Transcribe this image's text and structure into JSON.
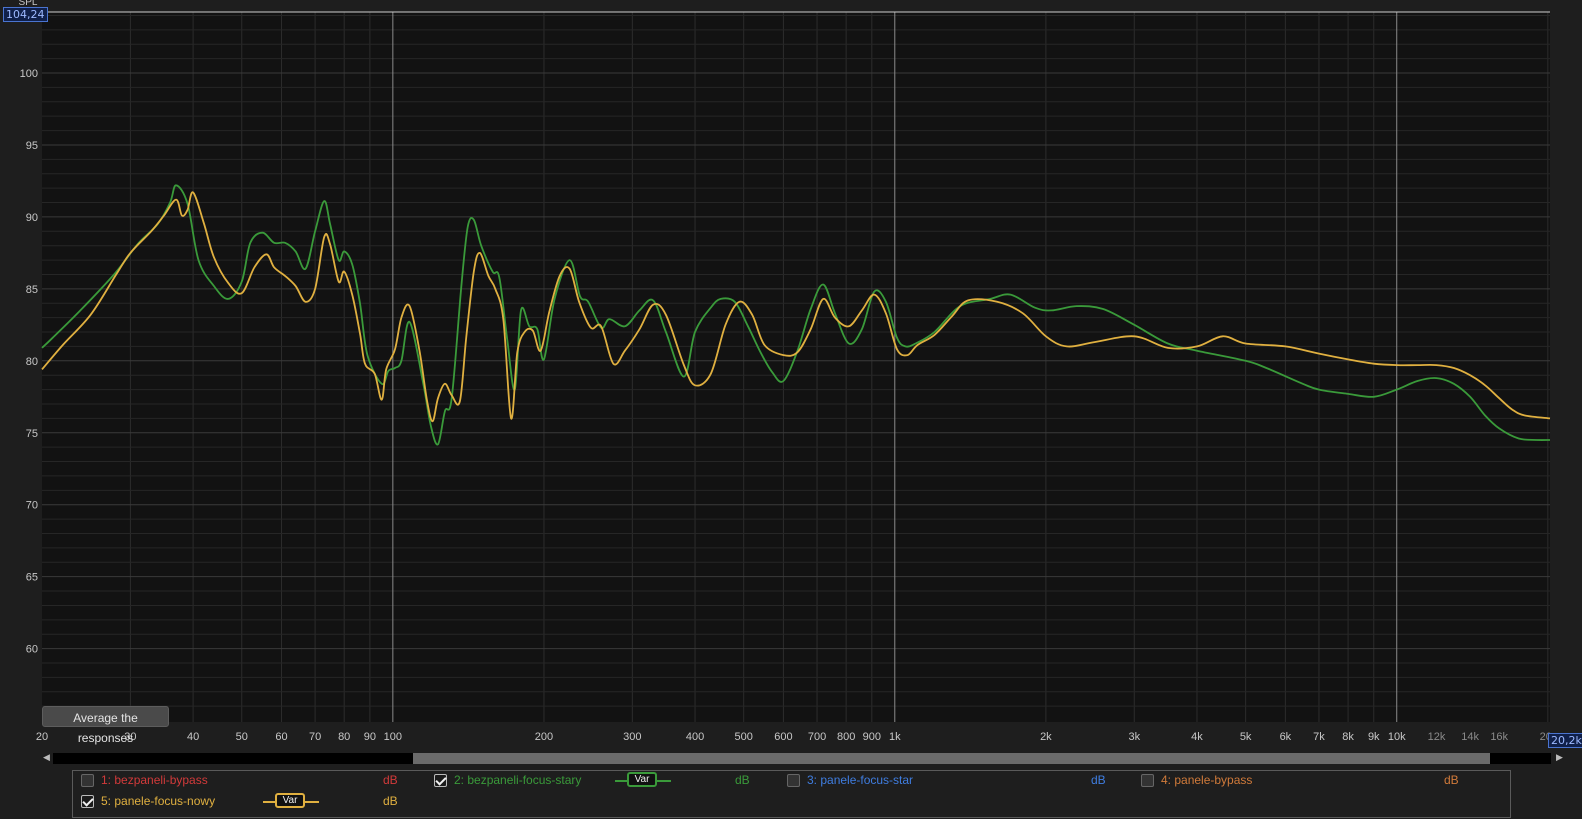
{
  "cursor": {
    "y_readout": "104,24",
    "x_readout": "20,2k",
    "y_axis_unit": "SPL"
  },
  "buttons": {
    "average_label": "Average the responses"
  },
  "legend": [
    {
      "name": "1: bezpaneli-bypass",
      "unit": "dB",
      "checked": false,
      "color": "#d23a3a",
      "show_var": false
    },
    {
      "name": "2: bezpaneli-focus-stary",
      "unit": "dB",
      "checked": true,
      "color": "#3a9a3a",
      "show_var": true,
      "var_label": "Var"
    },
    {
      "name": "3: panele-focus-star",
      "unit": "dB",
      "checked": false,
      "color": "#3f7de0",
      "show_var": false
    },
    {
      "name": "4: panele-bypass",
      "unit": "dB",
      "checked": false,
      "color": "#d07a3a",
      "show_var": false
    },
    {
      "name": "5: panele-focus-nowy",
      "unit": "dB",
      "checked": true,
      "color": "#e0b040",
      "show_var": true,
      "var_label": "Var"
    }
  ],
  "chart_data": {
    "type": "line",
    "title": "",
    "xlabel": "",
    "ylabel": "SPL",
    "x_scale": "log",
    "xlim": [
      20,
      20200
    ],
    "ylim": [
      54.9,
      104.24
    ],
    "grid": true,
    "y_ticks": [
      60,
      65,
      70,
      75,
      80,
      85,
      90,
      95,
      100
    ],
    "x_ticks": [
      {
        "v": 20,
        "label": "20"
      },
      {
        "v": 30,
        "label": "30"
      },
      {
        "v": 40,
        "label": "40"
      },
      {
        "v": 50,
        "label": "50"
      },
      {
        "v": 60,
        "label": "60"
      },
      {
        "v": 70,
        "label": "70"
      },
      {
        "v": 80,
        "label": "80"
      },
      {
        "v": 90,
        "label": "90"
      },
      {
        "v": 100,
        "label": "100"
      },
      {
        "v": 200,
        "label": "200"
      },
      {
        "v": 300,
        "label": "300"
      },
      {
        "v": 400,
        "label": "400"
      },
      {
        "v": 500,
        "label": "500"
      },
      {
        "v": 600,
        "label": "600"
      },
      {
        "v": 700,
        "label": "700"
      },
      {
        "v": 800,
        "label": "800"
      },
      {
        "v": 900,
        "label": "900"
      },
      {
        "v": 1000,
        "label": "1k"
      },
      {
        "v": 2000,
        "label": "2k"
      },
      {
        "v": 3000,
        "label": "3k"
      },
      {
        "v": 4000,
        "label": "4k"
      },
      {
        "v": 5000,
        "label": "5k"
      },
      {
        "v": 6000,
        "label": "6k"
      },
      {
        "v": 7000,
        "label": "7k"
      },
      {
        "v": 8000,
        "label": "8k"
      },
      {
        "v": 9000,
        "label": "9k"
      },
      {
        "v": 10000,
        "label": "10k"
      },
      {
        "v": 12000,
        "label": "12k"
      },
      {
        "v": 14000,
        "label": "14k"
      },
      {
        "v": 16000,
        "label": "16k"
      },
      {
        "v": 20000,
        "label": "20"
      }
    ],
    "series": [
      {
        "name": "2: bezpaneli-focus-stary",
        "color": "#3a9a3a",
        "x": [
          20,
          21,
          24,
          28,
          31,
          34,
          36,
          37,
          39,
          41,
          44,
          47,
          50,
          52,
          55,
          58,
          61,
          64,
          67,
          70,
          73,
          75,
          78,
          80,
          83,
          86,
          89,
          95,
          98,
          101,
          104,
          108,
          115,
          119,
          123,
          127,
          131,
          137,
          141,
          145,
          150,
          158,
          163,
          169,
          175,
          180,
          187,
          194,
          200,
          210,
          225,
          236,
          245,
          260,
          270,
          290,
          310,
          330,
          350,
          380,
          400,
          430,
          450,
          480,
          510,
          540,
          570,
          600,
          640,
          680,
          720,
          760,
          810,
          860,
          910,
          960,
          1010,
          1050,
          1100,
          1200,
          1350,
          1550,
          1700,
          1900,
          2050,
          2300,
          2600,
          3000,
          3500,
          4000,
          5000,
          5500,
          6500,
          7000,
          8000,
          9000,
          10000,
          11000,
          12000,
          13000,
          14000,
          15000,
          16000,
          17500,
          19000,
          20200
        ],
        "y": [
          80.9,
          81.6,
          83.6,
          86.1,
          88.1,
          89.5,
          91.0,
          92.2,
          90.9,
          87.0,
          85.2,
          84.3,
          85.5,
          88.2,
          88.9,
          88.2,
          88.2,
          87.6,
          86.4,
          89.0,
          91.1,
          89.5,
          87.0,
          87.6,
          86.7,
          84.0,
          80.4,
          78.4,
          79.3,
          79.5,
          80.0,
          82.7,
          78.4,
          75.5,
          74.2,
          76.5,
          77.4,
          85.3,
          89.3,
          89.8,
          88.0,
          86.2,
          85.8,
          81.5,
          78.0,
          83.5,
          82.4,
          82.2,
          80.1,
          84.3,
          87.0,
          84.5,
          84.1,
          82.3,
          82.9,
          82.4,
          83.5,
          84.2,
          82.0,
          78.9,
          82.0,
          83.7,
          84.3,
          84.1,
          82.4,
          80.6,
          79.2,
          78.6,
          80.7,
          83.6,
          85.3,
          83.3,
          81.2,
          82.2,
          84.8,
          84.1,
          81.6,
          81.0,
          81.2,
          82.0,
          83.8,
          84.3,
          84.6,
          83.7,
          83.5,
          83.8,
          83.6,
          82.5,
          81.2,
          80.7,
          80.0,
          79.5,
          78.4,
          78.0,
          77.7,
          77.5,
          78.0,
          78.6,
          78.8,
          78.4,
          77.5,
          76.2,
          75.3,
          74.6,
          74.5,
          74.5
        ]
      },
      {
        "name": "5: panele-focus-nowy",
        "color": "#e0b040",
        "x": [
          20,
          22,
          25,
          28,
          30,
          33,
          35,
          37,
          38,
          39,
          40,
          42,
          44,
          47,
          50,
          53,
          56,
          58,
          61,
          64,
          67,
          70,
          73,
          75,
          78,
          80,
          83,
          86,
          88,
          92,
          95,
          97,
          101,
          104,
          108,
          113,
          117,
          120,
          123,
          127,
          131,
          136,
          140,
          145,
          149,
          155,
          160,
          166,
          172,
          177,
          183,
          190,
          197,
          205,
          215,
          225,
          235,
          248,
          260,
          275,
          290,
          310,
          330,
          350,
          380,
          400,
          430,
          460,
          490,
          520,
          550,
          600,
          640,
          680,
          720,
          760,
          810,
          860,
          910,
          960,
          1010,
          1060,
          1110,
          1200,
          1300,
          1400,
          1600,
          1800,
          2000,
          2200,
          2500,
          3000,
          3500,
          4000,
          4500,
          5000,
          6000,
          7000,
          8000,
          9000,
          10000,
          11000,
          12000,
          13000,
          14000,
          15000,
          16000,
          17000,
          18000,
          20200
        ],
        "y": [
          79.4,
          81.1,
          83.2,
          85.9,
          87.5,
          89.0,
          90.1,
          91.2,
          90.1,
          90.5,
          91.7,
          89.6,
          87.2,
          85.4,
          84.7,
          86.5,
          87.4,
          86.5,
          85.9,
          85.2,
          84.1,
          85.0,
          88.6,
          88.1,
          85.5,
          86.2,
          84.6,
          81.9,
          79.8,
          79.1,
          77.3,
          79.4,
          80.8,
          83.0,
          83.8,
          80.7,
          77.2,
          75.8,
          77.4,
          78.4,
          77.6,
          77.2,
          81.6,
          86.2,
          87.5,
          85.9,
          85.0,
          82.9,
          76.0,
          80.6,
          82.0,
          82.1,
          80.7,
          83.4,
          85.9,
          86.4,
          84.1,
          82.3,
          82.4,
          79.8,
          80.7,
          82.2,
          83.9,
          83.2,
          79.7,
          78.3,
          79.1,
          82.5,
          84.1,
          83.2,
          81.1,
          80.4,
          80.6,
          82.2,
          84.3,
          83.0,
          82.4,
          83.5,
          84.6,
          83.3,
          80.8,
          80.4,
          81.1,
          81.8,
          83.1,
          84.2,
          84.1,
          83.3,
          81.7,
          81.0,
          81.3,
          81.7,
          80.9,
          81.0,
          81.7,
          81.2,
          81.0,
          80.5,
          80.1,
          79.8,
          79.7,
          79.7,
          79.7,
          79.5,
          79.0,
          78.3,
          77.4,
          76.6,
          76.2,
          76.0
        ]
      }
    ]
  }
}
